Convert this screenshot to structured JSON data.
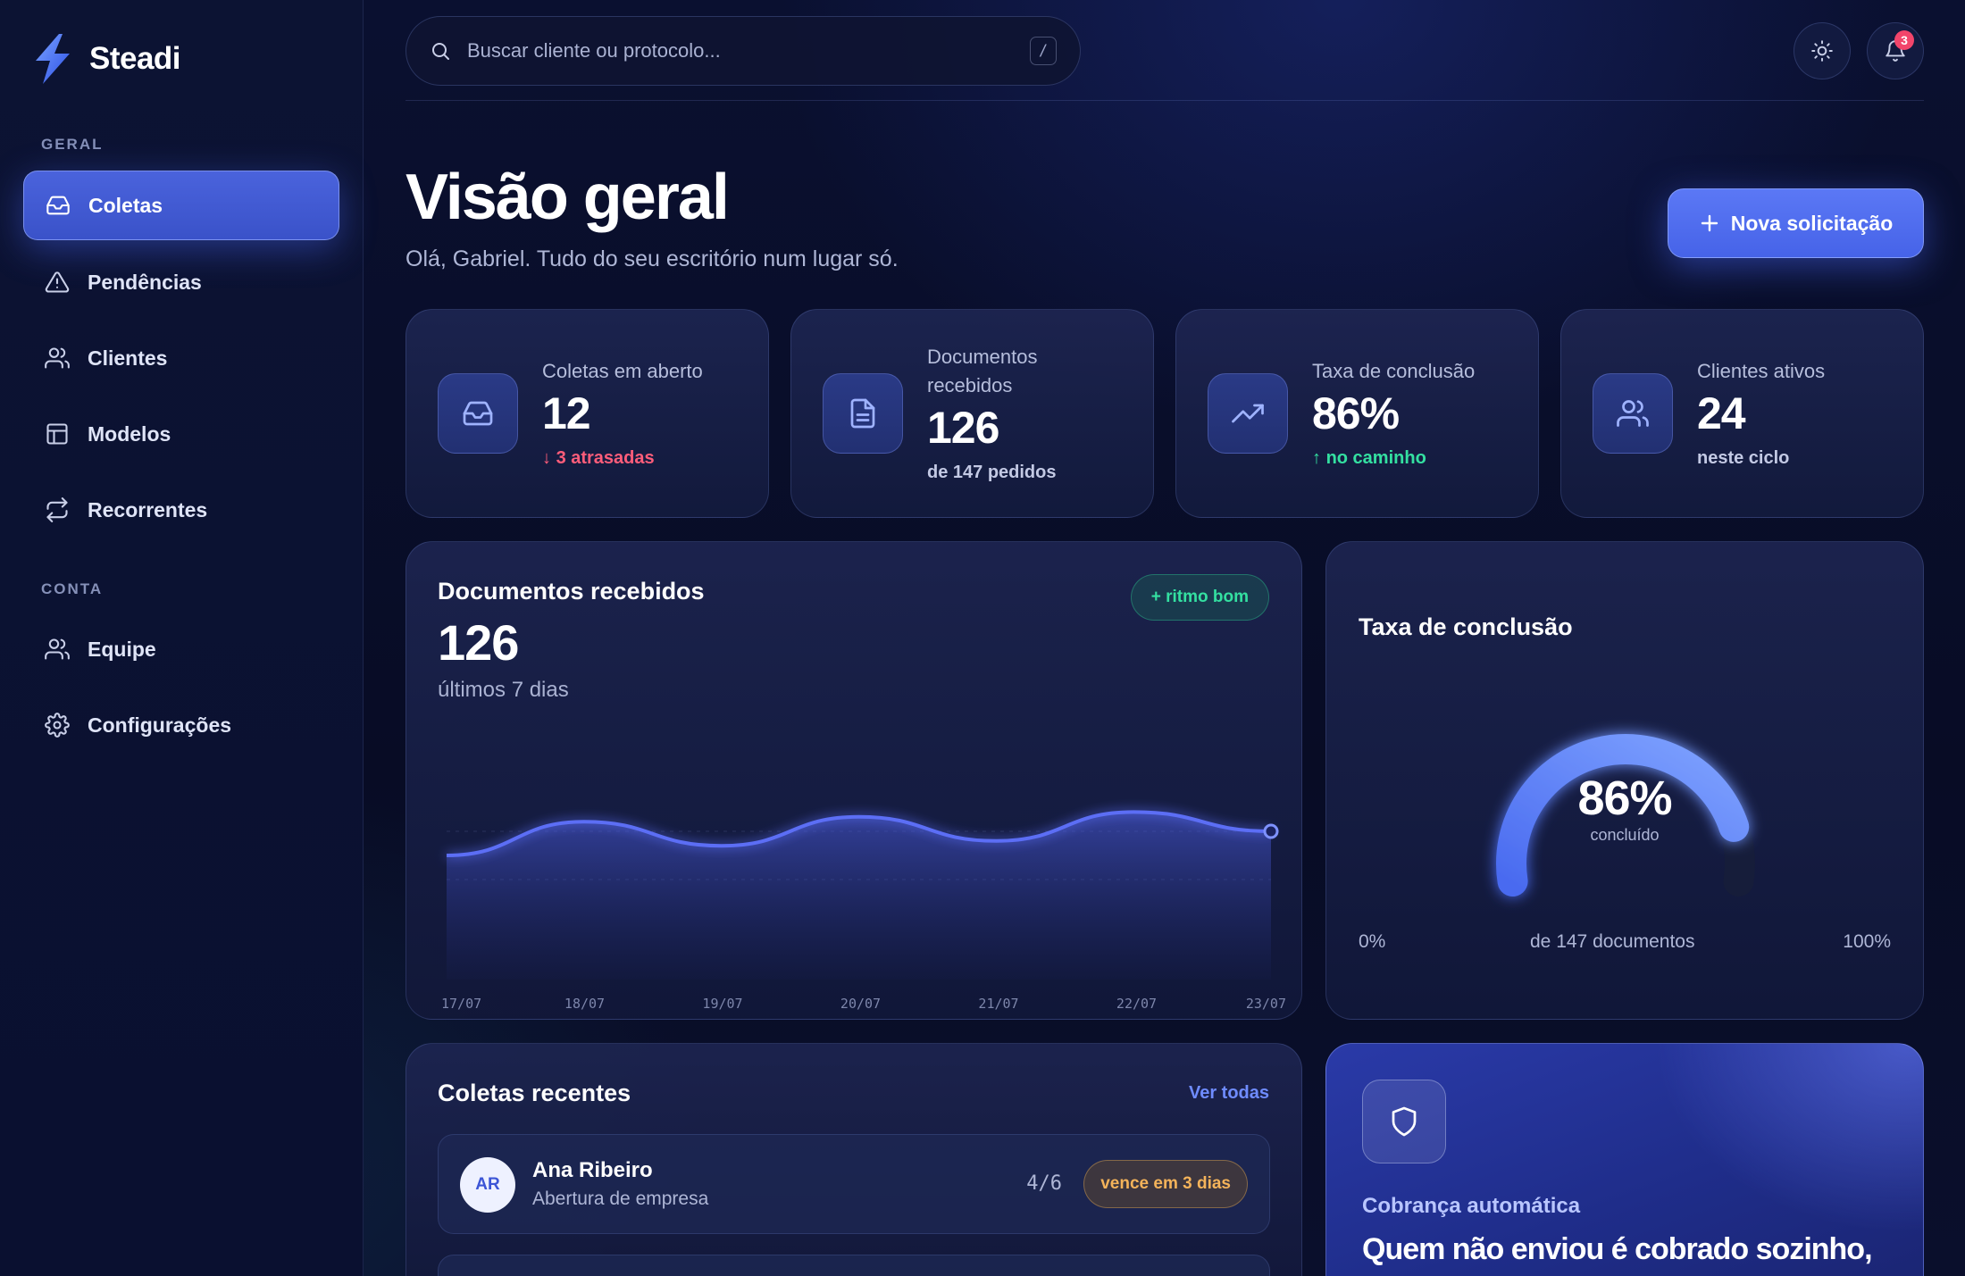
{
  "brand": {
    "name": "Steadi"
  },
  "sidebar": {
    "section_geral": "GERAL",
    "section_conta": "CONTA",
    "items": [
      {
        "label": "Coletas",
        "icon": "inbox-icon",
        "active": true
      },
      {
        "label": "Pendências",
        "icon": "alert-triangle-icon",
        "active": false
      },
      {
        "label": "Clientes",
        "icon": "users-icon",
        "active": false
      },
      {
        "label": "Modelos",
        "icon": "layout-icon",
        "active": false
      },
      {
        "label": "Recorrentes",
        "icon": "repeat-icon",
        "active": false
      }
    ],
    "account_items": [
      {
        "label": "Equipe",
        "icon": "users-icon"
      },
      {
        "label": "Configurações",
        "icon": "gear-icon"
      }
    ]
  },
  "topbar": {
    "search_placeholder": "Buscar cliente ou protocolo...",
    "search_shortcut": "/",
    "notification_count": "3"
  },
  "header": {
    "title": "Visão geral",
    "subtitle": "Olá, Gabriel. Tudo do seu escritório num lugar só.",
    "primary_action": "Nova solicitação"
  },
  "stats": [
    {
      "label": "Coletas em aberto",
      "value": "12",
      "note": "3 atrasadas",
      "note_tone": "red",
      "icon": "inbox-icon"
    },
    {
      "label": "Documentos recebidos",
      "value": "126",
      "note": "de 147 pedidos",
      "note_tone": "neutral",
      "icon": "file-text-icon"
    },
    {
      "label": "Taxa de conclusão",
      "value": "86%",
      "note": "no caminho",
      "note_tone": "green",
      "icon": "trending-up-icon"
    },
    {
      "label": "Clientes ativos",
      "value": "24",
      "note": "neste ciclo",
      "note_tone": "neutral",
      "icon": "users-icon"
    }
  ],
  "documents_panel": {
    "title": "Documentos recebidos",
    "value": "126",
    "subtitle": "últimos 7 dias",
    "badge": "+ ritmo bom"
  },
  "chart_data": {
    "type": "area",
    "title": "Documentos recebidos",
    "x": [
      "17/07",
      "18/07",
      "19/07",
      "20/07",
      "21/07",
      "22/07",
      "23/07"
    ],
    "series": [
      {
        "values": [
          15,
          22,
          17,
          23,
          18,
          24,
          20
        ]
      }
    ],
    "ylim": [
      0,
      30
    ],
    "grid": true,
    "color": "#5b6ef5"
  },
  "completion_panel": {
    "title": "Taxa de conclusão",
    "value": "86%",
    "caption": "concluído",
    "percent": 86,
    "min_label": "0%",
    "mid_label": "de 147 documentos",
    "max_label": "100%"
  },
  "recent": {
    "title": "Coletas recentes",
    "link": "Ver todas",
    "rows": [
      {
        "initials": "AR",
        "name": "Ana Ribeiro",
        "desc": "Abertura de empresa",
        "count": "4/6",
        "status": "vence em 3 dias"
      }
    ]
  },
  "promo": {
    "kicker": "Cobrança automática",
    "title": "Quem não enviou é cobrado sozinho, via WhatsApp"
  },
  "colors": {
    "accent": "#4a63dc",
    "danger": "#ff5d7a",
    "success": "#34e0a1",
    "warning": "#f4b35a"
  }
}
